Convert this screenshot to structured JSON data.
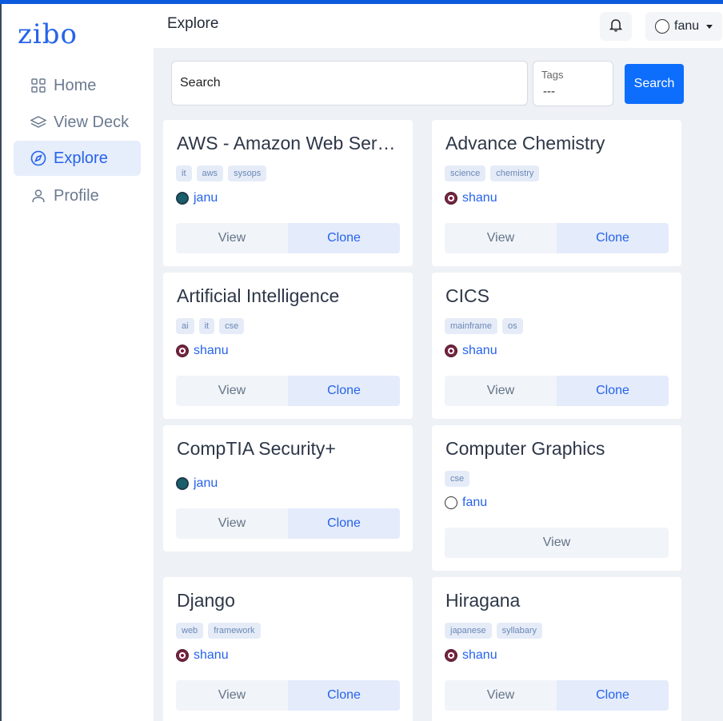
{
  "app": {
    "logo": "zibo"
  },
  "sidebar": {
    "items": [
      {
        "label": "Home",
        "icon": "grid-icon"
      },
      {
        "label": "View Deck",
        "icon": "layers-icon"
      },
      {
        "label": "Explore",
        "icon": "compass-icon",
        "active": true
      },
      {
        "label": "Profile",
        "icon": "user-icon"
      }
    ]
  },
  "header": {
    "title": "Explore",
    "user": "fanu"
  },
  "search": {
    "placeholder": "Search",
    "tags_label": "Tags",
    "tags_value": "---",
    "button_label": "Search"
  },
  "cards": [
    {
      "title": "AWS - Amazon Web Services",
      "tags": [
        "it",
        "aws",
        "sysops"
      ],
      "author": "janu",
      "view": "View",
      "clone": "Clone"
    },
    {
      "title": "Advance Chemistry",
      "tags": [
        "science",
        "chemistry"
      ],
      "author": "shanu",
      "view": "View",
      "clone": "Clone"
    },
    {
      "title": "Artificial Intelligence",
      "tags": [
        "ai",
        "it",
        "cse"
      ],
      "author": "shanu",
      "view": "View",
      "clone": "Clone"
    },
    {
      "title": "CICS",
      "tags": [
        "mainframe",
        "os"
      ],
      "author": "shanu",
      "view": "View",
      "clone": "Clone"
    },
    {
      "title": "CompTIA Security+",
      "tags": [],
      "author": "janu",
      "view": "View",
      "clone": "Clone"
    },
    {
      "title": "Computer Graphics",
      "tags": [
        "cse"
      ],
      "author": "fanu",
      "view": "View"
    },
    {
      "title": "Django",
      "tags": [
        "web",
        "framework"
      ],
      "author": "shanu",
      "view": "View",
      "clone": "Clone"
    },
    {
      "title": "Hiragana",
      "tags": [
        "japanese",
        "syllabary"
      ],
      "author": "shanu",
      "view": "View",
      "clone": "Clone"
    }
  ],
  "colors": {
    "accent": "#0d6efd",
    "brand": "#2563eb",
    "background": "#eef1f5"
  }
}
